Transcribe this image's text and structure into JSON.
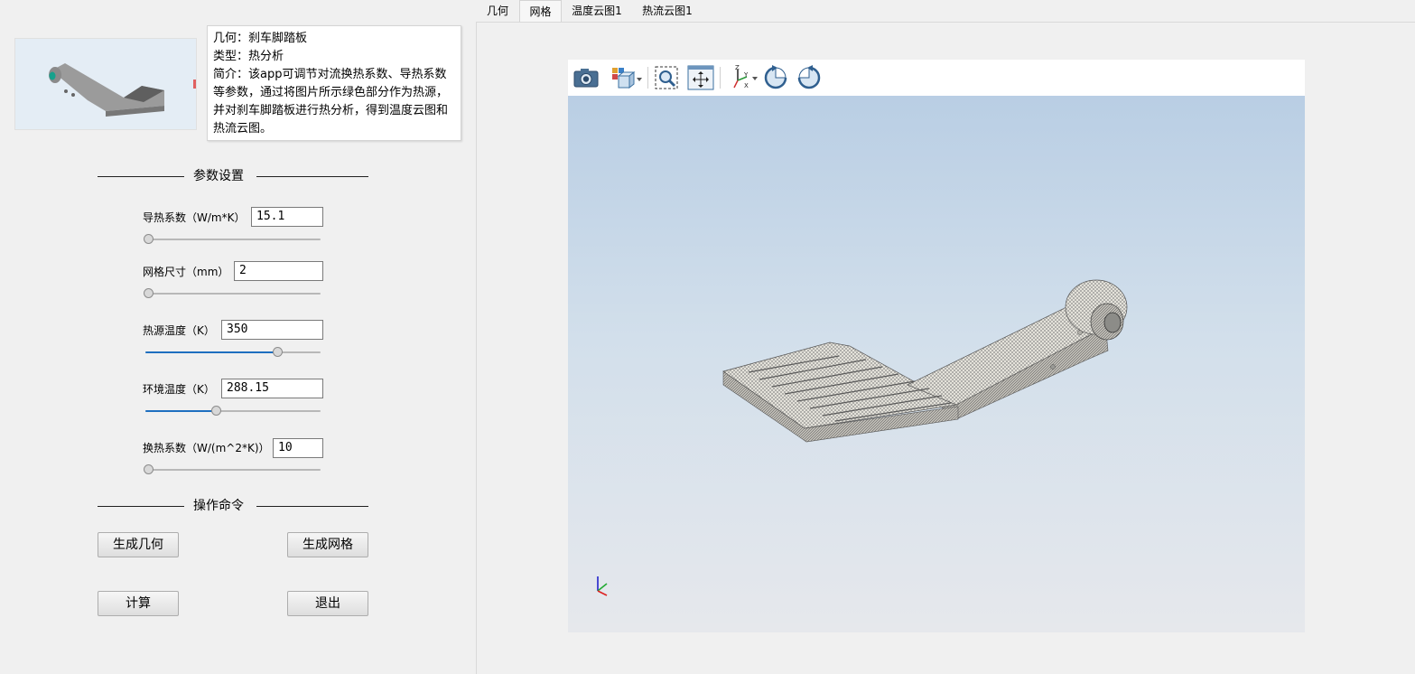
{
  "app_info": {
    "geometry_line": "几何：刹车脚踏板",
    "type_line": "类型：热分析",
    "intro_line": "简介：该app可调节对流换热系数、导热系数等参数，通过将图片所示绿色部分作为热源，并对刹车脚踏板进行热分析，得到温度云图和热流云图。"
  },
  "params_section_title": "参数设置",
  "params": [
    {
      "label": "导热系数（W/m*K）",
      "value": "15.1",
      "slider_fraction": 0.0
    },
    {
      "label": "网格尺寸（mm）",
      "value": "2",
      "slider_fraction": 0.0
    },
    {
      "label": "热源温度（K）",
      "value": "350",
      "slider_fraction": 0.76
    },
    {
      "label": "环境温度（K）",
      "value": "288.15",
      "slider_fraction": 0.4
    },
    {
      "label": "换热系数（W/(m^2*K)）",
      "value": "10",
      "slider_fraction": 0.0
    }
  ],
  "commands_section_title": "操作命令",
  "buttons": {
    "gen_geometry": "生成几何",
    "gen_mesh": "生成网格",
    "compute": "计算",
    "exit": "退出"
  },
  "tabs": [
    {
      "label": "几何",
      "active": false
    },
    {
      "label": "网格",
      "active": true
    },
    {
      "label": "温度云图1",
      "active": false
    },
    {
      "label": "热流云图1",
      "active": false
    }
  ],
  "viewer_toolbar": [
    "camera-icon",
    "display-mode-icon",
    "zoom-box-icon",
    "fit-view-icon",
    "axes-orientation-icon",
    "rotate-ccw-icon",
    "rotate-cw-icon"
  ],
  "colors": {
    "slider_fill": "#1e6fc0",
    "mesh_body": "#e8e6de",
    "viewer_top": "#b9cee4",
    "viewer_bottom": "#e6e8ec"
  }
}
